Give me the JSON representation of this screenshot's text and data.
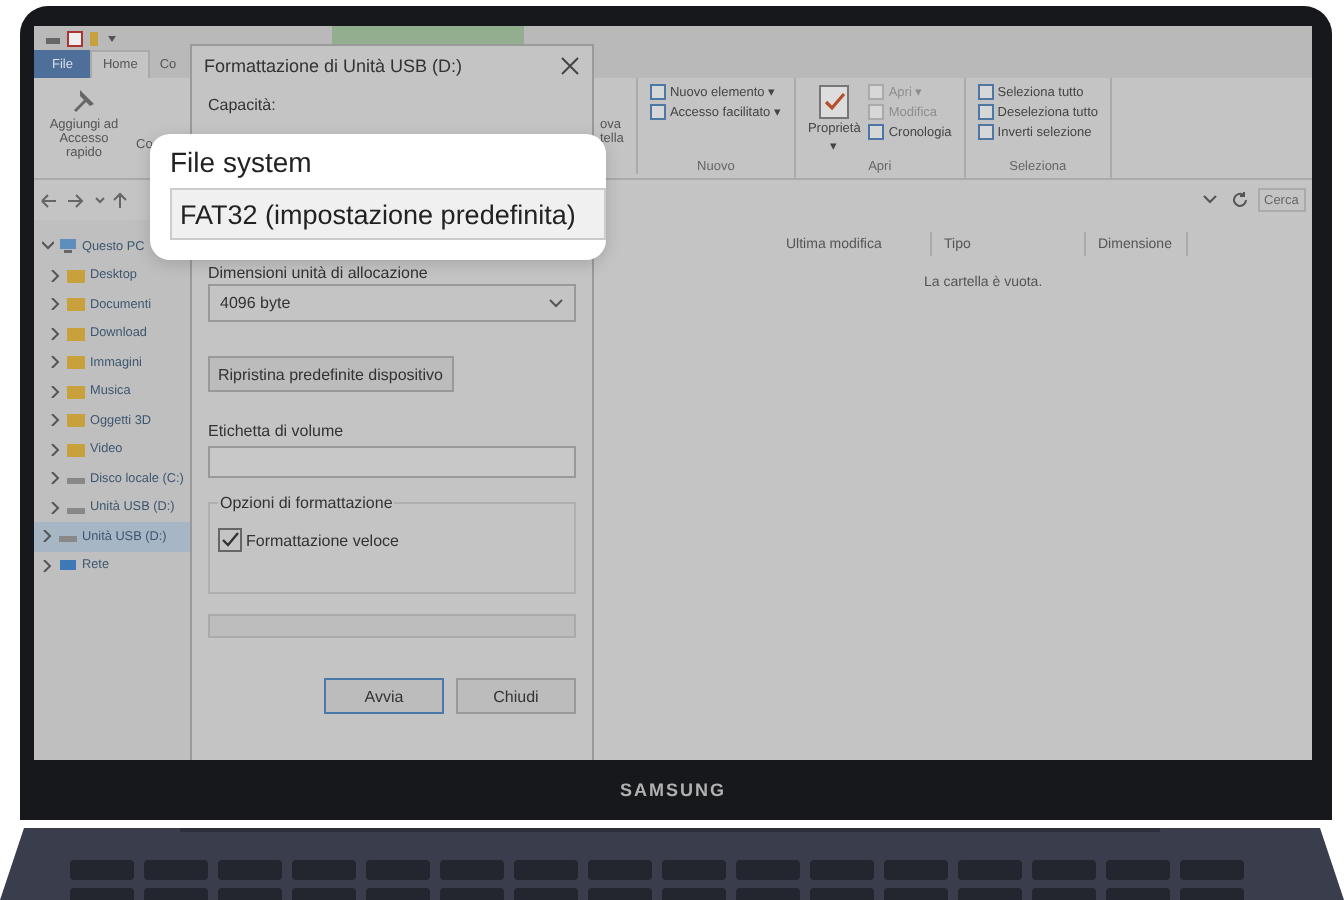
{
  "explorer": {
    "ribbon_tabs": [
      {
        "label": "File",
        "kind": "file",
        "selected": false
      },
      {
        "label": "Home",
        "kind": "tab",
        "selected": true
      },
      {
        "label": "Co",
        "kind": "tab",
        "selected": false
      }
    ],
    "pin_button": {
      "label": "Aggiungi ad Accesso rapido"
    },
    "copy_button": {
      "label": "Co"
    },
    "new_folder_button": {
      "lines": [
        "ova",
        "tella"
      ]
    },
    "ribbon_groups": [
      {
        "label": "Nuovo",
        "commands": [
          {
            "label": "Nuovo elemento ▾",
            "disabled": false
          },
          {
            "label": "Accesso facilitato ▾",
            "disabled": false
          }
        ]
      },
      {
        "label": "Apri",
        "big": {
          "label": "Proprietà",
          "caret": "▾"
        },
        "commands": [
          {
            "label": "Apri ▾",
            "disabled": true
          },
          {
            "label": "Modifica",
            "disabled": true
          },
          {
            "label": "Cronologia",
            "disabled": false
          }
        ]
      },
      {
        "label": "Seleziona",
        "commands": [
          {
            "label": "Seleziona tutto",
            "disabled": false
          },
          {
            "label": "Deseleziona tutto",
            "disabled": false
          },
          {
            "label": "Inverti selezione",
            "disabled": false
          }
        ]
      }
    ],
    "search": {
      "placeholder": "Cerca"
    },
    "nav_tree": [
      {
        "label": "Questo PC",
        "kind": "pc",
        "expanded": true,
        "selected": false,
        "children": [
          {
            "label": "Desktop",
            "kind": "folder",
            "expanded": false,
            "selected": false
          },
          {
            "label": "Documenti",
            "kind": "folder",
            "expanded": false,
            "selected": false
          },
          {
            "label": "Download",
            "kind": "folder",
            "expanded": false,
            "selected": false
          },
          {
            "label": "Immagini",
            "kind": "folder",
            "expanded": false,
            "selected": false
          },
          {
            "label": "Musica",
            "kind": "folder",
            "expanded": false,
            "selected": false
          },
          {
            "label": "Oggetti 3D",
            "kind": "folder",
            "expanded": false,
            "selected": false
          },
          {
            "label": "Video",
            "kind": "folder",
            "expanded": false,
            "selected": false
          },
          {
            "label": "Disco locale (C:)",
            "kind": "drive",
            "expanded": false,
            "selected": false
          },
          {
            "label": "Unità USB (D:)",
            "kind": "drive",
            "expanded": false,
            "selected": false
          }
        ]
      },
      {
        "label": "Unità USB (D:)",
        "kind": "drive",
        "expanded": false,
        "selected": true
      },
      {
        "label": "Rete",
        "kind": "network",
        "expanded": false,
        "selected": false
      }
    ],
    "columns": [
      "Ultima modifica",
      "Tipo",
      "Dimensione"
    ],
    "empty_message": "La cartella è vuota."
  },
  "dialog": {
    "title": "Formattazione di Unità USB (D:)",
    "capacity_label": "Capacità:",
    "allocation_label": "Dimensioni unità di allocazione",
    "allocation_value": "4096 byte",
    "restore_button": "Ripristina predefinite dispositivo",
    "volume_label": "Etichetta di volume",
    "options_legend": "Opzioni di formattazione",
    "quick_format": {
      "label": "Formattazione veloce",
      "checked": true
    },
    "progress": {
      "level": 0
    },
    "buttons": [
      {
        "label": "Avvia",
        "default": true
      },
      {
        "label": "Chiudi",
        "default": false
      }
    ]
  },
  "callout": {
    "label": "File system",
    "value": "FAT32 (impostazione predefinita)"
  },
  "laptop": {
    "brand": "SAMSUNG"
  }
}
